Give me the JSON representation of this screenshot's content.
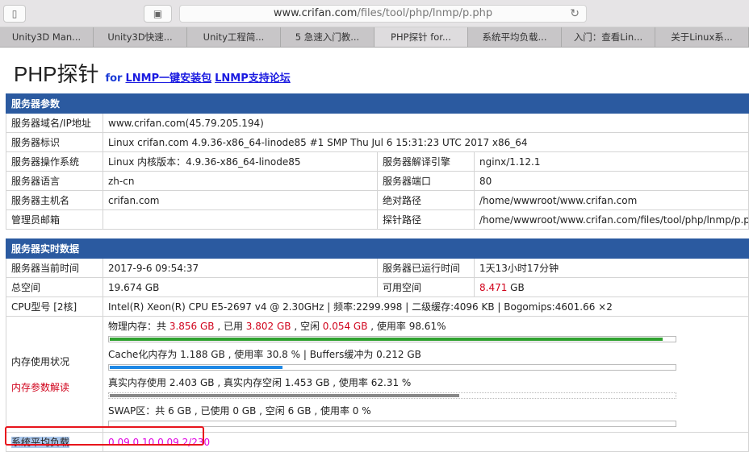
{
  "browser": {
    "url_host": "www.crifan.com",
    "url_path": "/files/tool/php/lnmp/p.php",
    "tabs": [
      "Unity3D Man...",
      "Unity3D快速...",
      "Unity工程简...",
      "5 急速入门教...",
      "PHP探针 for...",
      "系统平均负载...",
      "入门：查看Lin...",
      "关于Linux系..."
    ],
    "active_tab": 4
  },
  "page": {
    "title": "PHP探针",
    "for": "for",
    "link1": "LNMP一键安装包",
    "link2": "LNMP支持论坛"
  },
  "server_params": {
    "header": "服务器参数",
    "domain_label": "服务器域名/IP地址",
    "domain": "www.crifan.com(45.79.205.194)",
    "id_label": "服务器标识",
    "id": "Linux crifan.com 4.9.36-x86_64-linode85 #1 SMP Thu Jul 6 15:31:23 UTC 2017 x86_64",
    "os_label": "服务器操作系统",
    "os": "Linux  内核版本：4.9.36-x86_64-linode85",
    "engine_label": "服务器解译引擎",
    "engine": "nginx/1.12.1",
    "lang_label": "服务器语言",
    "lang": "zh-cn",
    "port_label": "服务器端口",
    "port": "80",
    "host_label": "服务器主机名",
    "host": "crifan.com",
    "abspath_label": "绝对路径",
    "abspath": "/home/wwwroot/www.crifan.com",
    "email_label": "管理员邮箱",
    "email": "",
    "probe_label": "探针路径",
    "probe": "/home/wwwroot/www.crifan.com/files/tool/php/lnmp/p.php"
  },
  "realtime": {
    "header": "服务器实时数据",
    "time_label": "服务器当前时间",
    "time": "2017-9-6 09:54:37",
    "uptime_label": "服务器已运行时间",
    "uptime": "1天13小时17分钟",
    "space_label": "总空间",
    "space": "19.674 GB",
    "free_label": "可用空间",
    "free_value": "8.471",
    "free_unit": " GB",
    "cpu_label": "CPU型号 [2核]",
    "cpu": "Intel(R) Xeon(R) CPU E5-2697 v4 @ 2.30GHz | 频率:2299.998 | 二级缓存:4096 KB | Bogomips:4601.66 ×2",
    "mem_label": "内存使用状况",
    "mem_link": "内存参数解读",
    "phys": {
      "p1": "物理内存：共 ",
      "total": "3.856 GB",
      "p2": " , 已用 ",
      "used": "3.802 GB",
      "p3": " , 空闲 ",
      "free": "0.054 GB",
      "p4": " , 使用率 98.61%",
      "percent": 98.61,
      "color": "#2ea12e"
    },
    "cache": {
      "text": "Cache化内存为 1.188 GB , 使用率 30.8 % | Buffers缓冲为 0.212 GB",
      "percent": 30.8,
      "color": "#1e88e5"
    },
    "real": {
      "text": "真实内存使用 2.403 GB , 真实内存空闲 1.453 GB , 使用率 62.31 %",
      "percent": 62.31,
      "color": "#888888"
    },
    "swap": {
      "text": "SWAP区：共 6 GB , 已使用 0 GB , 空闲 6 GB , 使用率 0 %",
      "percent": 0
    },
    "load_label": "系统平均负载",
    "load": "0.09 0.10 0.09 2/230"
  }
}
